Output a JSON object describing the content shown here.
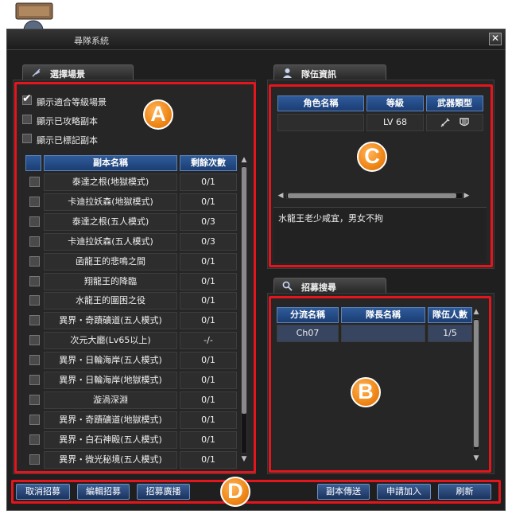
{
  "window": {
    "title": "尋隊系統",
    "close_glyph": "✕"
  },
  "scene_panel": {
    "tab_label": "選擇場景",
    "tab_icon": "feather-icon",
    "checkboxes": [
      {
        "label": "顯示適合等級場景",
        "checked": true
      },
      {
        "label": "顯示已攻略副本",
        "checked": false
      },
      {
        "label": "顯示已標記副本",
        "checked": false
      }
    ],
    "columns": [
      "副本名稱",
      "剩餘次數"
    ],
    "rows": [
      {
        "name": "泰達之根(地獄模式)",
        "remaining": "0/1"
      },
      {
        "name": "卡迪拉妖森(地獄模式)",
        "remaining": "0/1"
      },
      {
        "name": "泰達之根(五人模式)",
        "remaining": "0/3"
      },
      {
        "name": "卡迪拉妖森(五人模式)",
        "remaining": "0/3"
      },
      {
        "name": "函龍王的悲鳴之間",
        "remaining": "0/1"
      },
      {
        "name": "翔龍王的降臨",
        "remaining": "0/1"
      },
      {
        "name": "水龍王的圍困之役",
        "remaining": "0/1"
      },
      {
        "name": "異界・奇蹟礦道(五人模式)",
        "remaining": "0/1"
      },
      {
        "name": "次元大廳(Lv65以上)",
        "remaining": "-/-"
      },
      {
        "name": "異界・日輪海岸(五人模式)",
        "remaining": "0/1"
      },
      {
        "name": "異界・日輪海岸(地獄模式)",
        "remaining": "0/1"
      },
      {
        "name": "漩渦深淵",
        "remaining": "0/1"
      },
      {
        "name": "異界・奇蹟礦道(地獄模式)",
        "remaining": "0/1"
      },
      {
        "name": "異界・白石神殿(五人模式)",
        "remaining": "0/1"
      },
      {
        "name": "異界・微光秘境(五人模式)",
        "remaining": "0/1"
      }
    ]
  },
  "team_panel": {
    "tab_label": "隊伍資訊",
    "tab_icon": "person-icon",
    "columns": [
      "角色名稱",
      "等級",
      "武器類型"
    ],
    "member": {
      "name": "",
      "level": "LV 68",
      "weapon_icons": [
        "sword-icon",
        "shield-icon"
      ]
    },
    "note": "水龍王老少咸宜，男女不拘"
  },
  "recruit_panel": {
    "tab_label": "招募搜尋",
    "tab_icon": "magnifier-icon",
    "columns": [
      "分流名稱",
      "隊長名稱",
      "隊伍人數"
    ],
    "rows": [
      {
        "channel": "Ch07",
        "leader": "",
        "members": "1/5"
      }
    ]
  },
  "buttons": {
    "cancel_recruit": "取消招募",
    "edit_recruit": "編輯招募",
    "broadcast_recruit": "招募廣播",
    "dungeon_teleport": "副本傳送",
    "apply_join": "申請加入",
    "refresh": "刷新"
  },
  "badges": {
    "a": "A",
    "b": "B",
    "c": "C",
    "d": "D"
  },
  "colors": {
    "highlight_red": "#e4151c",
    "badge_orange": "#f08a1a",
    "header_blue": "#2f5b9a"
  }
}
